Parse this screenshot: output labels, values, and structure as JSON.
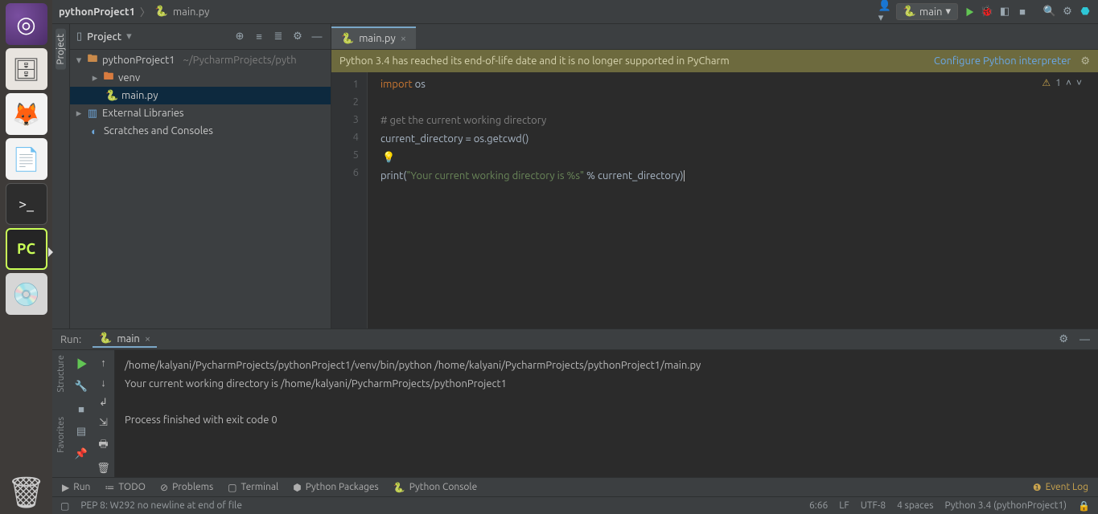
{
  "launcher": {
    "pycharm_label": "PC"
  },
  "breadcrumb": {
    "project": "pythonProject1",
    "file": "main.py"
  },
  "navbar": {
    "config_label": "main"
  },
  "project_panel": {
    "title": "Project",
    "root": "pythonProject1",
    "root_path": "~/PycharmProjects/pyth",
    "venv": "venv",
    "mainfile": "main.py",
    "ext_libs": "External Libraries",
    "scratches": "Scratches and Consoles"
  },
  "tab": {
    "name": "main.py"
  },
  "banner": {
    "msg": "Python 3.4 has reached its end-of-life date and it is no longer supported in PyCharm",
    "link": "Configure Python interpreter"
  },
  "inspections": {
    "warn_icon": "⚠",
    "count": "1"
  },
  "code_lines": [
    "1",
    "2",
    "3",
    "4",
    "5",
    "6"
  ],
  "code": {
    "l1_kw": "import",
    "l1_rest": " os",
    "l3": "# get the current working directory",
    "l4": "current_directory = os.getcwd()",
    "l6_fn": "print",
    "l6_p1": "(",
    "l6_str": "\"Your current working directory is %s\"",
    "l6_mid": " % current_directory",
    "l6_p2": ")"
  },
  "run": {
    "title": "Run:",
    "tab": "main",
    "cmd": "/home/kalyani/PycharmProjects/pythonProject1/venv/bin/python /home/kalyani/PycharmProjects/pythonProject1/main.py",
    "out": "Your current working directory is /home/kalyani/PycharmProjects/pythonProject1",
    "exit": "Process finished with exit code 0"
  },
  "left_rail": {
    "project": "Project"
  },
  "run_rail": {
    "structure": "Structure",
    "favorites": "Favorites"
  },
  "bottom": {
    "run": "Run",
    "todo": "TODO",
    "problems": "Problems",
    "terminal": "Terminal",
    "pypkg": "Python Packages",
    "pycons": "Python Console",
    "event": "Event Log"
  },
  "status": {
    "msg": "PEP 8: W292 no newline at end of file",
    "pos": "6:66",
    "lf": "LF",
    "enc": "UTF-8",
    "indent": "4 spaces",
    "interp": "Python 3.4 (pythonProject1)"
  }
}
